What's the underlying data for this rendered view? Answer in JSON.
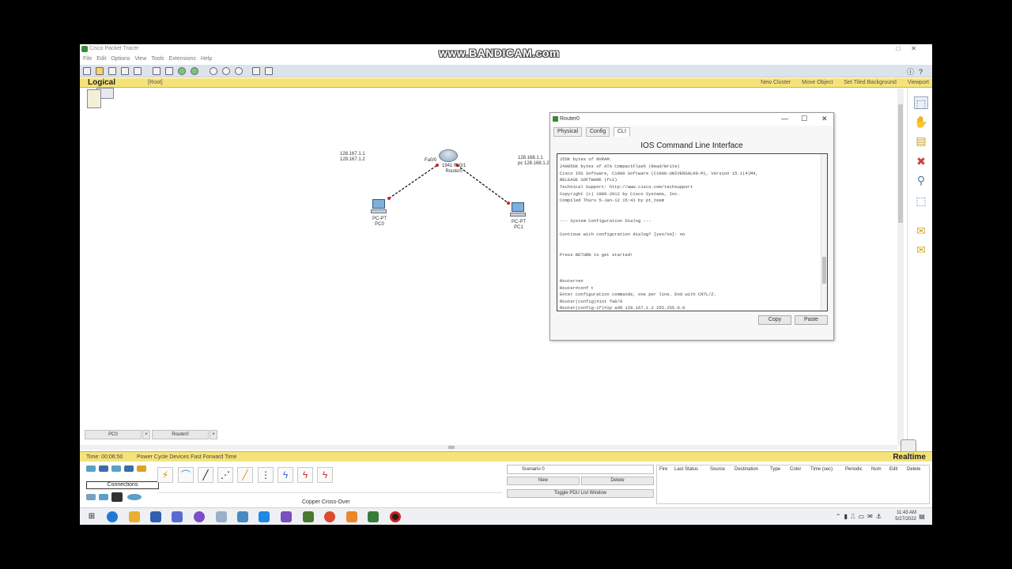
{
  "watermark": "www.BANDICAM.com",
  "window": {
    "title": "Cisco Packet Tracer",
    "controls": [
      "□",
      "✕"
    ]
  },
  "menu": [
    "File",
    "Edit",
    "Options",
    "View",
    "Tools",
    "Extensions",
    "Help"
  ],
  "logical_bar": {
    "mode": "Logical",
    "path": "[Root]",
    "right_items": [
      "New Cluster",
      "Move Object",
      "Set Tiled Background",
      "Viewport"
    ]
  },
  "topology": {
    "pc0": {
      "name": "PC0",
      "type": "PC-PT",
      "ip1": "128.167.1.1",
      "ip2": "129.167.1.2"
    },
    "pc1": {
      "name": "PC1",
      "type": "PC-PT",
      "ip1": "128.168.1.1",
      "ip2": "pc 128.168.1.2"
    },
    "router": {
      "name": "Router0",
      "model": "1941",
      "port_left": "Fa0/0",
      "port_right": "Fa0/1"
    }
  },
  "workspace_tabs": [
    "PC0",
    "Router0"
  ],
  "status_bar": {
    "time": "Time: 00:06:50",
    "cycle": "Power Cycle Devices  Fast Forward Time",
    "mode": "Realtime"
  },
  "bottom": {
    "connections_label": "Connections",
    "cable_selected": "Copper Cross-Over",
    "scenario": "Scenario 0",
    "new_btn": "New",
    "delete_btn": "Delete",
    "toggle_btn": "Toggle PDU List Window",
    "pdu_headers": [
      "Fire",
      "Last Status",
      "Source",
      "Destination",
      "Type",
      "Color",
      "Time (sec)",
      "Periodic",
      "Num",
      "Edit",
      "Delete"
    ]
  },
  "taskbar": {
    "time": "11:43 AM",
    "date": "5/27/2022"
  },
  "dialog": {
    "title": "Router0",
    "tabs": [
      "Physical",
      "Config",
      "CLI"
    ],
    "cli_heading": "IOS Command Line Interface",
    "lines": [
      "255K bytes of NVRAM.",
      "249856K bytes of ATA CompactFlash (Read/Write)",
      "Cisco IOS Software, C1900 Software (C1900-UNIVERSALK9-M), Version 15.1(4)M4,",
      "RELEASE SOFTWARE (fc2)",
      "Technical Support: http://www.cisco.com/techsupport",
      "Copyright (c) 1986-2012 by Cisco Systems, Inc.",
      "Compiled Thurs 5-Jan-12 15:41 by pt_team",
      "",
      "          --- System Configuration Dialog ---",
      "",
      "Continue with configuration dialog? [yes/no]: no",
      "",
      "",
      "Press RETURN to get started!",
      "",
      "",
      "",
      "Router>en",
      "Router#conf t",
      "Enter configuration commands, one per line.  End with CNTL/Z.",
      "Router(config)#int fa0/0",
      "Router(config-if)#ip add 128.167.1.2 255.255.0.0"
    ],
    "copy_btn": "Copy",
    "paste_btn": "Paste"
  }
}
